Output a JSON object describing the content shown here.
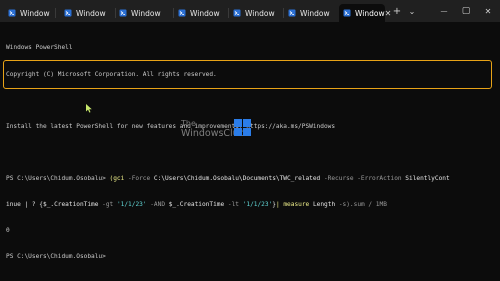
{
  "tabs": [
    {
      "label": "Window"
    },
    {
      "label": "Window"
    },
    {
      "label": "Window"
    },
    {
      "label": "Window"
    },
    {
      "label": "Window"
    },
    {
      "label": "Window"
    },
    {
      "label": "Window",
      "active": true
    }
  ],
  "window_controls": {
    "new_tab": "+",
    "dropdown": "⌄",
    "minimize": "—",
    "maximize": "▢",
    "close": "✕"
  },
  "terminal": {
    "header_line1": "Windows PowerShell",
    "header_line2": "Copyright (C) Microsoft Corporation. All rights reserved.",
    "install_line": "Install the latest PowerShell for new features and improvements! https://aka.ms/PSWindows",
    "prompt": "PS C:\\Users\\Chidum.Osobalu> ",
    "cmd": {
      "p1": "(gci",
      "p2": " -Force ",
      "p3": "C:\\Users\\Chidum.Osobalu\\Documents\\TWC_related",
      "p4": " -Recurse -ErrorAction ",
      "p5": "SilentlyCont",
      "p6": "inue",
      "p7": " | ? ",
      "p8": "{$_.CreationTime",
      "p9": " -gt ",
      "p10": "'1/1/23'",
      "p11": " -AND ",
      "p12": "$_.CreationTime",
      "p13": " -lt ",
      "p14": "'1/1/23'",
      "p15": "}",
      "p16": "| measure ",
      "p17": "Length",
      "p18": " -s).sum / 1MB"
    },
    "result": "0",
    "prompt2": "PS C:\\Users\\Chidum.Osobalu>"
  },
  "watermark": {
    "line1": "The",
    "line2": "WindowsClub"
  },
  "colors": {
    "highlight": "#e8a317",
    "background": "#0c0c0c",
    "titlebar": "#202020"
  }
}
